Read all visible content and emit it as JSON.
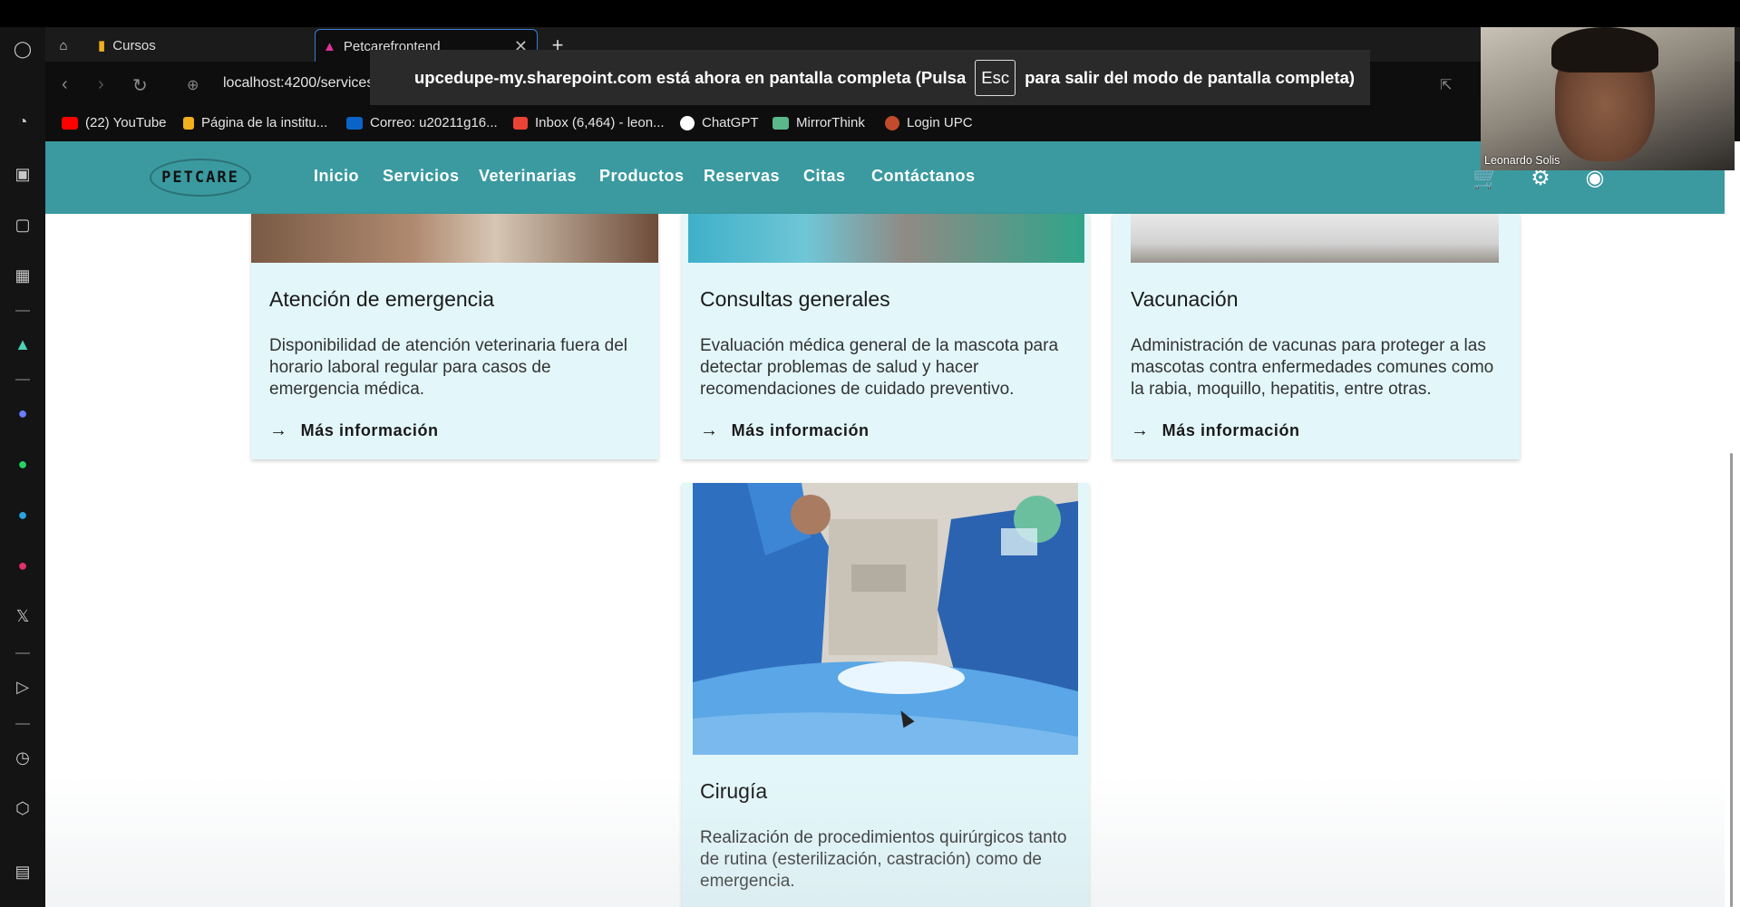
{
  "browser": {
    "tabs": [
      {
        "label": "Cursos",
        "icon": "bar-chart-icon"
      },
      {
        "label": "Petcarefrontend",
        "icon": "angular-icon",
        "active": true
      }
    ],
    "url": "localhost:4200/services",
    "bookmarks": [
      {
        "label": "(22) YouTube",
        "icon": "youtube-icon",
        "color": "#ff0000"
      },
      {
        "label": "Página de la institu...",
        "icon": "bar-chart-icon",
        "color": "#f2b01e"
      },
      {
        "label": "Correo: u20211g16...",
        "icon": "outlook-icon",
        "color": "#0a64c8"
      },
      {
        "label": "Inbox (6,464) - leon...",
        "icon": "gmail-icon",
        "color": "#ea4335"
      },
      {
        "label": "ChatGPT",
        "icon": "chatgpt-icon",
        "color": "#ffffff"
      },
      {
        "label": "MirrorThink",
        "icon": "mirrorthink-icon",
        "color": "#5ab88a"
      },
      {
        "label": "Login UPC",
        "icon": "upc-icon",
        "color": "#c24b2b"
      }
    ]
  },
  "fullscreen_banner": {
    "before": "upcedupe-my.sharepoint.com está ahora en pantalla completa (Pulsa",
    "key": "Esc",
    "after": "para salir del modo de pantalla completa)"
  },
  "webcam": {
    "name": "Leonardo Solis"
  },
  "site": {
    "logo": "PETCARE",
    "menu": [
      "Inicio",
      "Servicios",
      "Veterinarias",
      "Productos",
      "Reservas",
      "Citas",
      "Contáctanos"
    ],
    "header_icons": [
      "cart-icon",
      "gear-icon",
      "account-icon"
    ],
    "accent": "#3a9aa0",
    "card_bg": "#e3f7fa",
    "more_label": "Más información",
    "services": [
      {
        "title": "Atención de emergencia",
        "desc": "Disponibilidad de atención veterinaria fuera del horario laboral regular para casos de emergencia médica."
      },
      {
        "title": "Consultas generales",
        "desc": "Evaluación médica general de la mascota para detectar problemas de salud y hacer recomendaciones de cuidado preventivo."
      },
      {
        "title": "Vacunación",
        "desc": "Administración de vacunas para proteger a las mascotas contra enfermedades comunes como la rabia, moquillo, hepatitis, entre otras."
      },
      {
        "title": "Cirugía",
        "desc": "Realización de procedimientos quirúrgicos tanto de rutina (esterilización, castración) como de emergencia."
      }
    ]
  }
}
